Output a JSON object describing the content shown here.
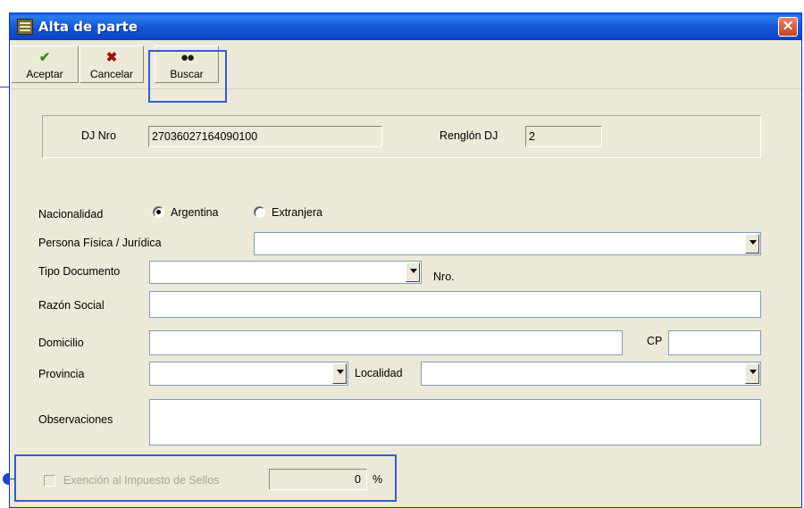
{
  "window": {
    "title": "Alta de parte",
    "close_symbol": "✕"
  },
  "toolbar": {
    "accept_label": "Aceptar",
    "cancel_label": "Cancelar",
    "search_label": "Buscar"
  },
  "header": {
    "dj_nro_label": "DJ Nro",
    "dj_nro_value": "27036027164090100",
    "renglon_label": "Renglón DJ",
    "renglon_value": "2"
  },
  "form": {
    "nacionalidad_label": "Nacionalidad",
    "option_argentina": "Argentina",
    "option_extranjera": "Extranjera",
    "nacionalidad_selected": "Argentina",
    "persona_label": "Persona Física / Jurídica",
    "persona_value": "",
    "tipo_doc_label": "Tipo Documento",
    "tipo_doc_value": "",
    "nro_label": "Nro.",
    "razon_social_label": "Razón Social",
    "razon_social_value": "",
    "domicilio_label": "Domicilio",
    "domicilio_value": "",
    "cp_label": "CP",
    "cp_value": "",
    "provincia_label": "Provincia",
    "provincia_value": "",
    "localidad_label": "Localidad",
    "localidad_value": "",
    "observaciones_label": "Observaciones",
    "observaciones_value": "",
    "exencion_label": "Exención al Impuesto de Sellos",
    "exencion_value": "0",
    "percent_symbol": "%"
  },
  "icons": [
    "check-icon",
    "cross-icon",
    "binoculars-icon",
    "app-icon",
    "close-icon"
  ],
  "colors": {
    "titlebar": "#1657d6",
    "window_bg": "#ece9d8",
    "highlight": "#2f5fd0"
  }
}
